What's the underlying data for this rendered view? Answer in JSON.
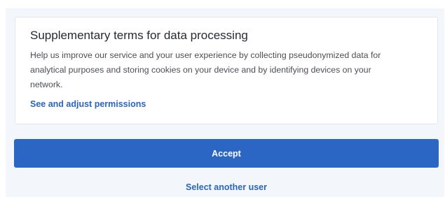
{
  "consent_card": {
    "title": "Supplementary terms for data processing",
    "description_lines": [
      "Help us improve our service and your user experience by collecting pseudonymized data for",
      "analytical purposes and storing cookies on your device and by identifying devices on your",
      "network."
    ],
    "link_label": "See and adjust permissions"
  },
  "actions": {
    "accept_label": "Accept",
    "select_user_label": "Select another user"
  },
  "colors": {
    "accent": "#2c66c5",
    "link": "#2a64c2",
    "background": "#f3f6fa"
  }
}
